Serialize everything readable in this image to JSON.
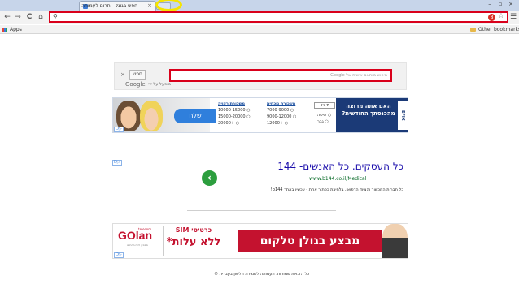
{
  "browser": {
    "tab_title": "חפש בגוגל - תרום לעמותה",
    "tab_close": "×",
    "window_controls": [
      "–",
      "▫",
      "×"
    ],
    "nav": {
      "back": "←",
      "forward": "→",
      "reload": "C",
      "home": "⌂"
    },
    "omnibox_value": "",
    "extension_badge": "8",
    "bookmarks": {
      "apps": "Apps",
      "other": "Other bookmarks"
    }
  },
  "google_search": {
    "button_label": "חפש",
    "clear": "×",
    "placeholder": "חיפוש מותאם אישית של Google",
    "logo": "Google",
    "powered_by": "מופעל על ידי"
  },
  "ad_banner_1": {
    "send_label": "שלח",
    "col_income_head": "משכורת רצויה",
    "col_income": [
      "10000-15000",
      "15000-20000",
      "20000+"
    ],
    "col_current_head": "משכורת נוכחית",
    "col_current": [
      "7000-9000",
      "9000-12000",
      "12000+"
    ],
    "dropdown": "גיל",
    "gender": [
      "אישה",
      "גבר"
    ],
    "headline": "האם אתה מרוצה מהכנסתך החודשית?",
    "logo_text": "EFIX",
    "adchoice": "D▷"
  },
  "text_ad": {
    "title": "כל העסקים. כל האנשים- 144",
    "url": "www.b144.co.il/Medical",
    "description": "כל חברות המכשור והציוד הרפואי, בלחיצת כפתור אחת - עכשיו באתר b144!",
    "arrow": "‹",
    "adchoice": "D▷"
  },
  "ad_banner_2": {
    "brand": "GOlan",
    "telecom": "telecom",
    "tagline": "מספיק לנוח מהחיים",
    "sim_line": "כרטיסי SIM",
    "free_line": "ללא עלות*",
    "red_text": "מבצע בגולן טלקום",
    "adchoice": "D▷"
  },
  "footer": "כל הזכויות שמורות. העמותה לשמירת הלשון בעברית © ."
}
